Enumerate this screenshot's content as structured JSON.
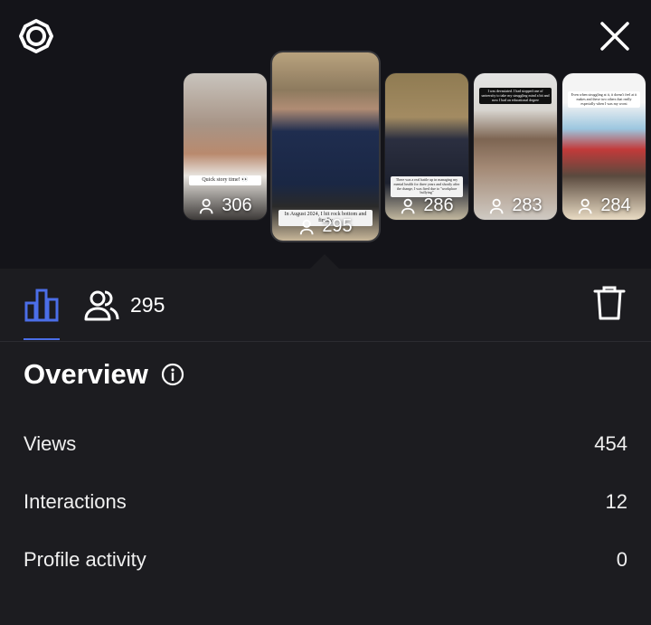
{
  "header": {
    "icons": {
      "settings": "gear-icon",
      "close": "close-icon"
    }
  },
  "stories": [
    {
      "viewers": "306",
      "caption": "Quick story time! 👀",
      "selected": false
    },
    {
      "viewers": "295",
      "caption": "In August 2024, I hit rock bottom and finally",
      "selected": true
    },
    {
      "viewers": "286",
      "caption": "There was a real battle up in managing my mental health for three years and shortly after the change, I was fired due to \"workplace bullying\"",
      "selected": false
    },
    {
      "viewers": "283",
      "caption": "I was devastated. I had stopped one of university to take my struggling mind a bit and now I had an educational degree",
      "selected": false
    },
    {
      "viewers": "284",
      "caption": "Even when struggling at it, it doesn't feel at it makes and these two others that really especially when I was my worst",
      "selected": false
    }
  ],
  "tabs": {
    "insights_icon": "bar-chart-icon",
    "viewers_icon": "viewers-icon",
    "viewer_count": "295",
    "delete_icon": "trash-icon"
  },
  "overview": {
    "title": "Overview",
    "info_icon": "info-icon"
  },
  "metrics": [
    {
      "label": "Views",
      "value": "454"
    },
    {
      "label": "Interactions",
      "value": "12"
    },
    {
      "label": "Profile activity",
      "value": "0"
    }
  ],
  "colors": {
    "accent": "#4b6ee8",
    "top_bg": "#141419",
    "panel_bg": "#1c1c20"
  }
}
